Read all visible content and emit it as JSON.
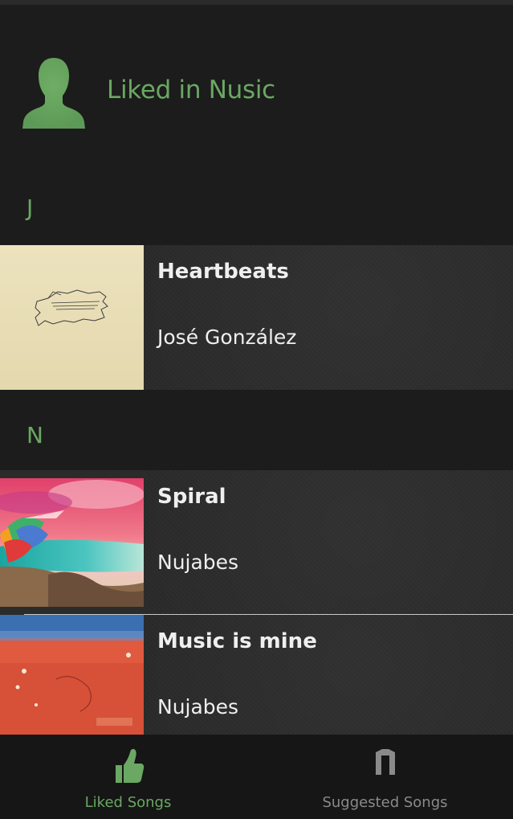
{
  "header": {
    "title": "Liked in Nusic",
    "avatar_icon": "person-silhouette-icon"
  },
  "sections": [
    {
      "letter": "J",
      "songs": [
        {
          "title": "Heartbeats",
          "artist": "José González",
          "artwork": "heartbeats-album-art"
        }
      ]
    },
    {
      "letter": "N",
      "songs": [
        {
          "title": "Spiral",
          "artist": "Nujabes",
          "artwork": "spiral-album-art"
        },
        {
          "title": "Music is mine",
          "artist": "Nujabes",
          "artwork": "modal-soul-album-art"
        }
      ]
    }
  ],
  "tabbar": {
    "tabs": [
      {
        "label": "Liked Songs",
        "icon": "thumbs-up-icon",
        "selected": true
      },
      {
        "label": "Suggested Songs",
        "icon": "suggested-icon",
        "selected": false
      }
    ]
  },
  "colors": {
    "accent": "#6aa863",
    "background": "#1c1c1c",
    "row_background": "#2b2b2b",
    "tab_inactive": "#8a8a8a",
    "text": "#efefef"
  }
}
